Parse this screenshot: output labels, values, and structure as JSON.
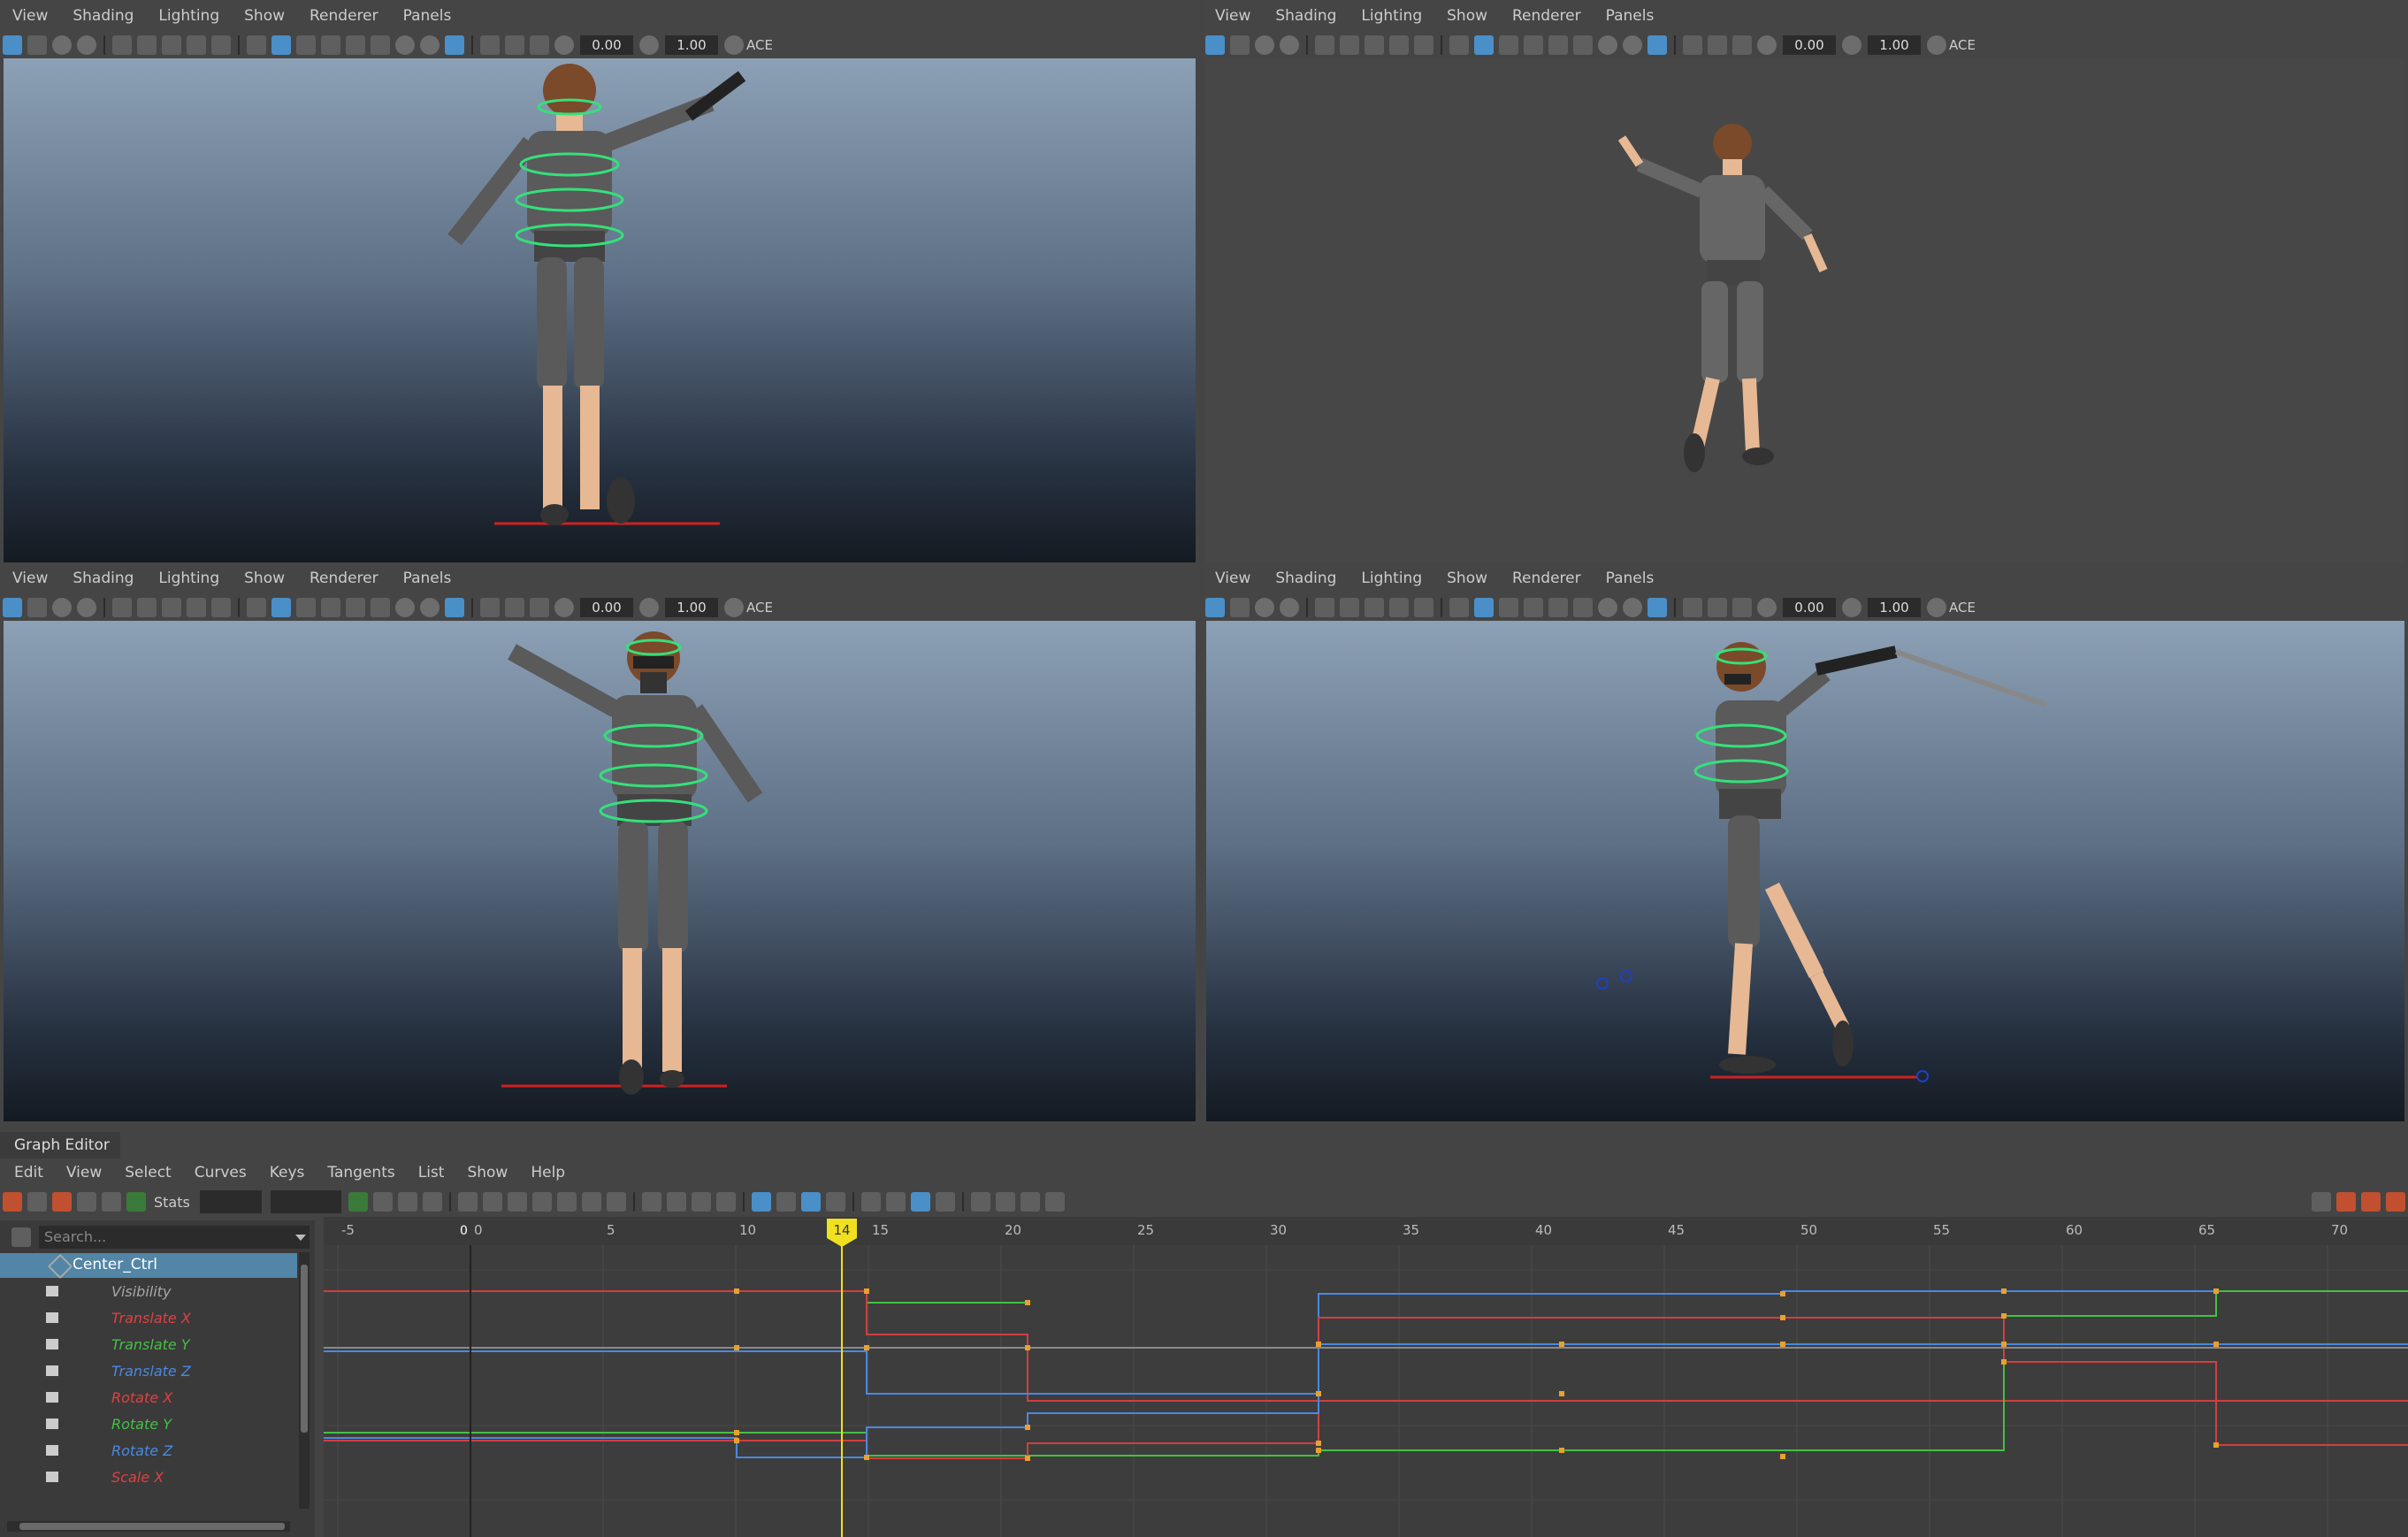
{
  "viewport_menu": [
    "View",
    "Shading",
    "Lighting",
    "Show",
    "Renderer",
    "Panels"
  ],
  "viewport_fields": {
    "exposure": "0.00",
    "gamma": "1.00",
    "aces_label": "ACE"
  },
  "graph_editor": {
    "title": "Graph Editor",
    "menu": [
      "Edit",
      "View",
      "Select",
      "Curves",
      "Keys",
      "Tangents",
      "List",
      "Show",
      "Help"
    ],
    "stats_label": "Stats",
    "search_placeholder": "Search...",
    "object": "Center_Ctrl",
    "attributes": [
      {
        "label": "Visibility",
        "color": "#a8a8a8"
      },
      {
        "label": "Translate X",
        "color": "#e04040"
      },
      {
        "label": "Translate Y",
        "color": "#44c044"
      },
      {
        "label": "Translate Z",
        "color": "#4a88e0"
      },
      {
        "label": "Rotate X",
        "color": "#e04040"
      },
      {
        "label": "Rotate Y",
        "color": "#44c044"
      },
      {
        "label": "Rotate Z",
        "color": "#4a88e0"
      },
      {
        "label": "Scale X",
        "color": "#e04040"
      }
    ],
    "current_frame": "14",
    "zero_marker": "0",
    "ruler_labels": [
      "-5",
      "0",
      "5",
      "10",
      "15",
      "20",
      "25",
      "30",
      "35",
      "40",
      "45",
      "50",
      "55",
      "60",
      "65",
      "70"
    ],
    "ruler_values": [
      -5,
      0,
      5,
      10,
      15,
      20,
      25,
      30,
      35,
      40,
      45,
      50,
      55,
      60,
      65,
      70
    ],
    "current_frame_value": 14
  },
  "colors": {
    "accent_blue": "#4a8fc7",
    "selection": "#5285a6",
    "timeline_marker": "#f0e020"
  }
}
